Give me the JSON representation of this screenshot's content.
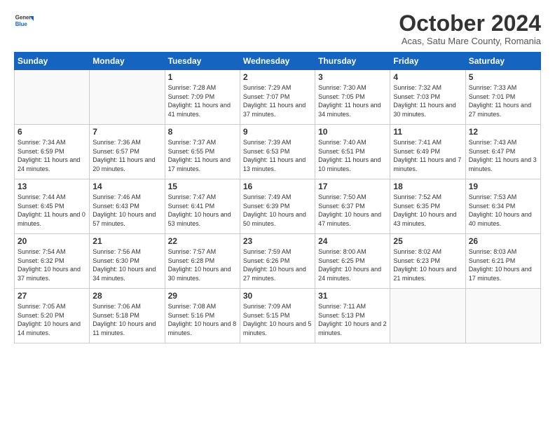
{
  "header": {
    "logo_general": "General",
    "logo_blue": "Blue",
    "month": "October 2024",
    "location": "Acas, Satu Mare County, Romania"
  },
  "weekdays": [
    "Sunday",
    "Monday",
    "Tuesday",
    "Wednesday",
    "Thursday",
    "Friday",
    "Saturday"
  ],
  "weeks": [
    [
      {
        "day": "",
        "info": ""
      },
      {
        "day": "",
        "info": ""
      },
      {
        "day": "1",
        "info": "Sunrise: 7:28 AM\nSunset: 7:09 PM\nDaylight: 11 hours and 41 minutes."
      },
      {
        "day": "2",
        "info": "Sunrise: 7:29 AM\nSunset: 7:07 PM\nDaylight: 11 hours and 37 minutes."
      },
      {
        "day": "3",
        "info": "Sunrise: 7:30 AM\nSunset: 7:05 PM\nDaylight: 11 hours and 34 minutes."
      },
      {
        "day": "4",
        "info": "Sunrise: 7:32 AM\nSunset: 7:03 PM\nDaylight: 11 hours and 30 minutes."
      },
      {
        "day": "5",
        "info": "Sunrise: 7:33 AM\nSunset: 7:01 PM\nDaylight: 11 hours and 27 minutes."
      }
    ],
    [
      {
        "day": "6",
        "info": "Sunrise: 7:34 AM\nSunset: 6:59 PM\nDaylight: 11 hours and 24 minutes."
      },
      {
        "day": "7",
        "info": "Sunrise: 7:36 AM\nSunset: 6:57 PM\nDaylight: 11 hours and 20 minutes."
      },
      {
        "day": "8",
        "info": "Sunrise: 7:37 AM\nSunset: 6:55 PM\nDaylight: 11 hours and 17 minutes."
      },
      {
        "day": "9",
        "info": "Sunrise: 7:39 AM\nSunset: 6:53 PM\nDaylight: 11 hours and 13 minutes."
      },
      {
        "day": "10",
        "info": "Sunrise: 7:40 AM\nSunset: 6:51 PM\nDaylight: 11 hours and 10 minutes."
      },
      {
        "day": "11",
        "info": "Sunrise: 7:41 AM\nSunset: 6:49 PM\nDaylight: 11 hours and 7 minutes."
      },
      {
        "day": "12",
        "info": "Sunrise: 7:43 AM\nSunset: 6:47 PM\nDaylight: 11 hours and 3 minutes."
      }
    ],
    [
      {
        "day": "13",
        "info": "Sunrise: 7:44 AM\nSunset: 6:45 PM\nDaylight: 11 hours and 0 minutes."
      },
      {
        "day": "14",
        "info": "Sunrise: 7:46 AM\nSunset: 6:43 PM\nDaylight: 10 hours and 57 minutes."
      },
      {
        "day": "15",
        "info": "Sunrise: 7:47 AM\nSunset: 6:41 PM\nDaylight: 10 hours and 53 minutes."
      },
      {
        "day": "16",
        "info": "Sunrise: 7:49 AM\nSunset: 6:39 PM\nDaylight: 10 hours and 50 minutes."
      },
      {
        "day": "17",
        "info": "Sunrise: 7:50 AM\nSunset: 6:37 PM\nDaylight: 10 hours and 47 minutes."
      },
      {
        "day": "18",
        "info": "Sunrise: 7:52 AM\nSunset: 6:35 PM\nDaylight: 10 hours and 43 minutes."
      },
      {
        "day": "19",
        "info": "Sunrise: 7:53 AM\nSunset: 6:34 PM\nDaylight: 10 hours and 40 minutes."
      }
    ],
    [
      {
        "day": "20",
        "info": "Sunrise: 7:54 AM\nSunset: 6:32 PM\nDaylight: 10 hours and 37 minutes."
      },
      {
        "day": "21",
        "info": "Sunrise: 7:56 AM\nSunset: 6:30 PM\nDaylight: 10 hours and 34 minutes."
      },
      {
        "day": "22",
        "info": "Sunrise: 7:57 AM\nSunset: 6:28 PM\nDaylight: 10 hours and 30 minutes."
      },
      {
        "day": "23",
        "info": "Sunrise: 7:59 AM\nSunset: 6:26 PM\nDaylight: 10 hours and 27 minutes."
      },
      {
        "day": "24",
        "info": "Sunrise: 8:00 AM\nSunset: 6:25 PM\nDaylight: 10 hours and 24 minutes."
      },
      {
        "day": "25",
        "info": "Sunrise: 8:02 AM\nSunset: 6:23 PM\nDaylight: 10 hours and 21 minutes."
      },
      {
        "day": "26",
        "info": "Sunrise: 8:03 AM\nSunset: 6:21 PM\nDaylight: 10 hours and 17 minutes."
      }
    ],
    [
      {
        "day": "27",
        "info": "Sunrise: 7:05 AM\nSunset: 5:20 PM\nDaylight: 10 hours and 14 minutes."
      },
      {
        "day": "28",
        "info": "Sunrise: 7:06 AM\nSunset: 5:18 PM\nDaylight: 10 hours and 11 minutes."
      },
      {
        "day": "29",
        "info": "Sunrise: 7:08 AM\nSunset: 5:16 PM\nDaylight: 10 hours and 8 minutes."
      },
      {
        "day": "30",
        "info": "Sunrise: 7:09 AM\nSunset: 5:15 PM\nDaylight: 10 hours and 5 minutes."
      },
      {
        "day": "31",
        "info": "Sunrise: 7:11 AM\nSunset: 5:13 PM\nDaylight: 10 hours and 2 minutes."
      },
      {
        "day": "",
        "info": ""
      },
      {
        "day": "",
        "info": ""
      }
    ]
  ]
}
